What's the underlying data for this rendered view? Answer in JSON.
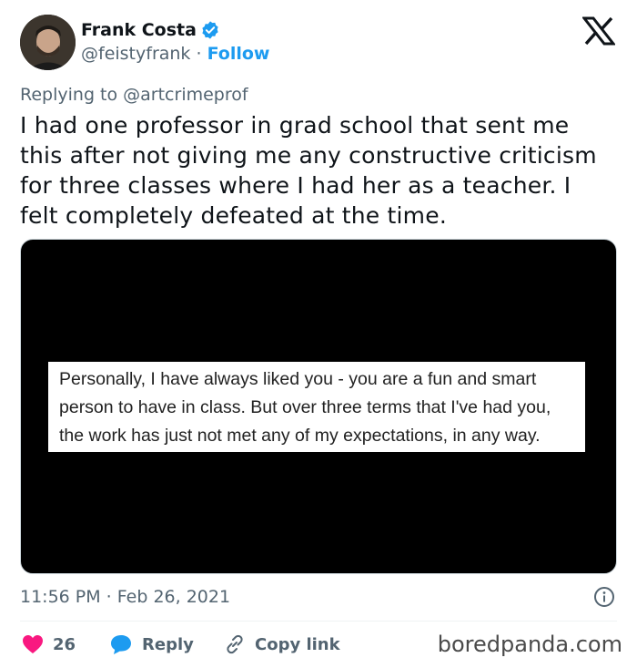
{
  "author": {
    "name": "Frank Costa",
    "handle": "@feistyfrank",
    "separator": "·",
    "follow_label": "Follow"
  },
  "reply_to": "Replying to @artcrimeprof",
  "tweet_lines": [
    "I had one professor in grad school that sent me",
    "this after not giving me any constructive criticism",
    "for three classes where I had her as a teacher. I",
    "felt completely defeated at the time."
  ],
  "media": {
    "quote_lines": [
      "Personally, I have always liked you - you are a fun and smart",
      "person to have in class. But over three terms that I've had you,",
      "the work has just not met any of my expectations, in any way."
    ]
  },
  "timestamp": "11:56 PM · Feb 26, 2021",
  "actions": {
    "like_count": "26",
    "reply_label": "Reply",
    "copy_label": "Copy link"
  },
  "watermark": "boredpanda.com",
  "colors": {
    "accent": "#1d9bf0",
    "like": "#f91880",
    "secondary_text": "#536471"
  }
}
